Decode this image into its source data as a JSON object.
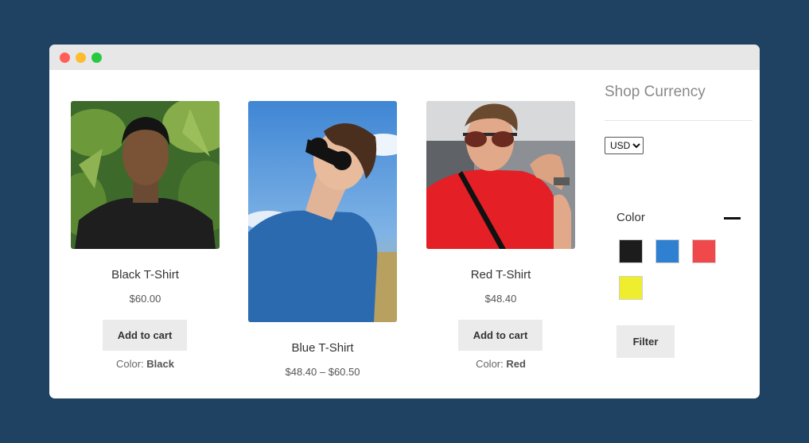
{
  "window": {
    "controls": [
      "close",
      "minimize",
      "maximize"
    ]
  },
  "products": [
    {
      "title": "Black T-Shirt",
      "price": "$60.00",
      "button": "Add to cart",
      "color_label": "Color:",
      "color_value": "Black",
      "shirt_color": "#1f1f1f"
    },
    {
      "title": "Blue T-Shirt",
      "price": "$48.40 – $60.50",
      "shirt_color": "#2d6fb5"
    },
    {
      "title": "Red T-Shirt",
      "price": "$48.40",
      "button": "Add to cart",
      "color_label": "Color:",
      "color_value": "Red",
      "shirt_color": "#e41f25"
    }
  ],
  "sidebar": {
    "currency_title": "Shop Currency",
    "currency_selected": "USD",
    "color_filter": {
      "heading": "Color",
      "swatches": [
        "#1c1c1c",
        "#2f80d0",
        "#f0494b",
        "#eeee2e"
      ],
      "filter_button": "Filter"
    }
  }
}
